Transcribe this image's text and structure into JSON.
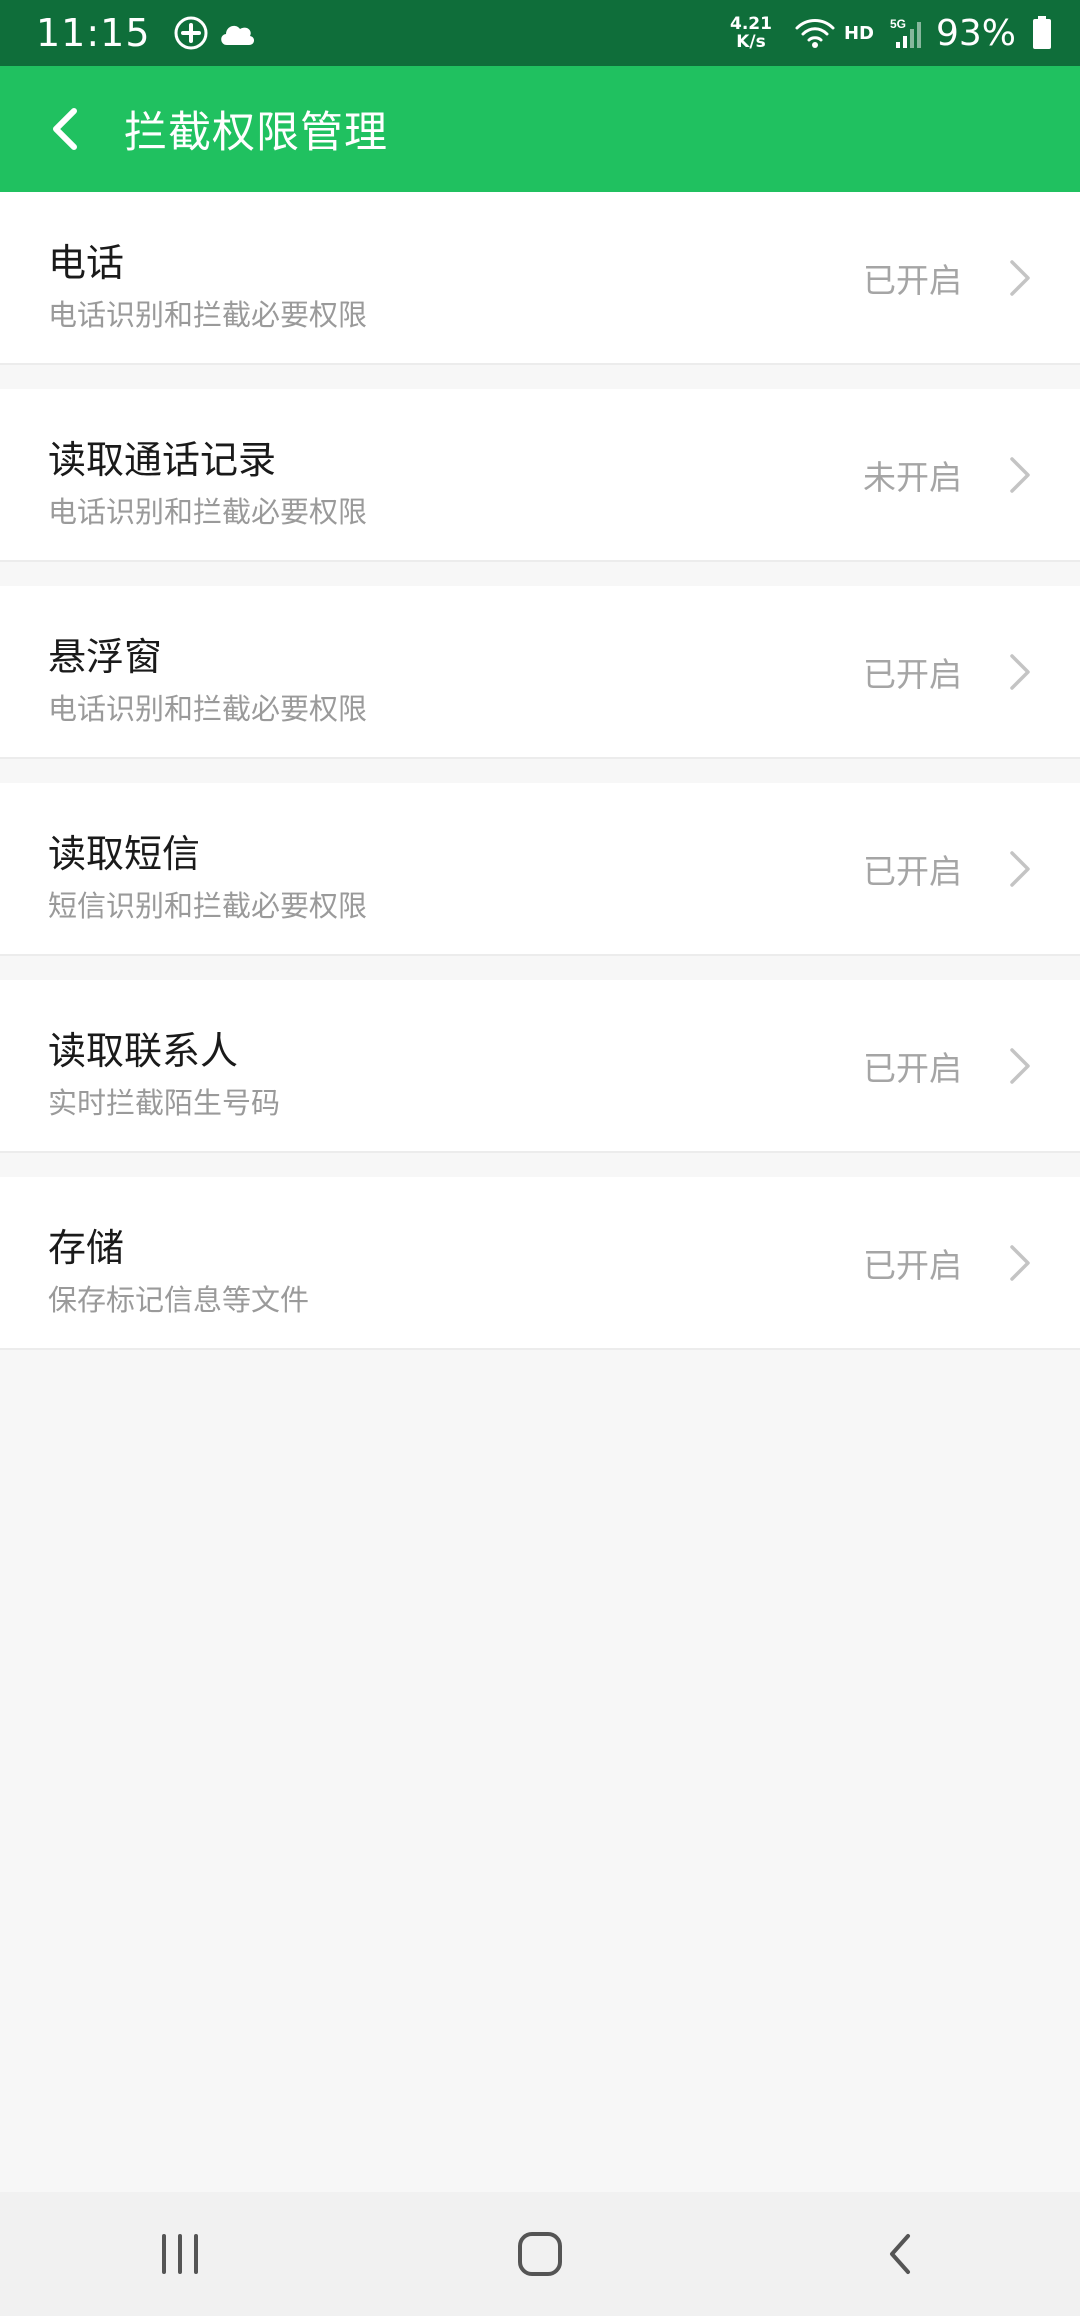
{
  "status_bar": {
    "time": "11:15",
    "net_speed_value": "4.21",
    "net_speed_unit": "K/s",
    "hd_label": "HD",
    "battery_percent": "93%",
    "icons": [
      "plus-circle-icon",
      "cloud-icon",
      "wifi-icon",
      "signal-5g-icon",
      "battery-icon"
    ]
  },
  "app_bar": {
    "title": "拦截权限管理",
    "back_icon": "chevron-left-icon"
  },
  "permissions": [
    {
      "title": "电话",
      "subtitle": "电话识别和拦截必要权限",
      "status": "已开启"
    },
    {
      "title": "读取通话记录",
      "subtitle": "电话识别和拦截必要权限",
      "status": "未开启"
    },
    {
      "title": "悬浮窗",
      "subtitle": "电话识别和拦截必要权限",
      "status": "已开启"
    },
    {
      "title": "读取短信",
      "subtitle": "短信识别和拦截必要权限",
      "status": "已开启"
    },
    {
      "title": "读取联系人",
      "subtitle": "实时拦截陌生号码",
      "status": "已开启"
    },
    {
      "title": "存储",
      "subtitle": "保存标记信息等文件",
      "status": "已开启"
    }
  ],
  "nav_bar": {
    "icons": [
      "recent-apps-icon",
      "home-icon",
      "back-icon"
    ]
  },
  "colors": {
    "status_bar_bg": "#0f6e3a",
    "app_bar_bg": "#20c160",
    "page_bg": "#f7f7f7",
    "status_text": "#a5a5a5"
  }
}
